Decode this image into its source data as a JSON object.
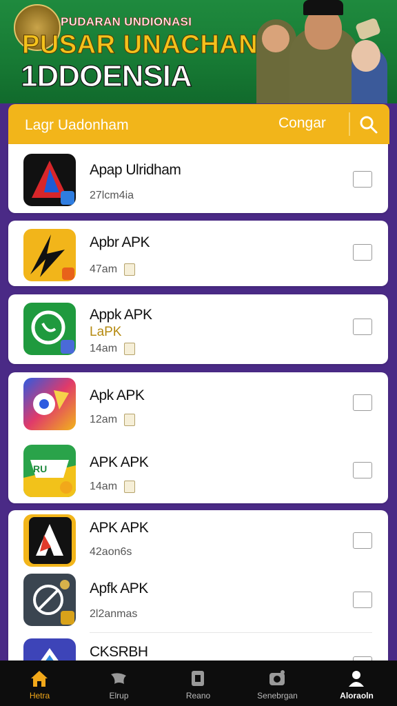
{
  "banner": {
    "subtitle": "PUDARAN UNDIONASI",
    "title_line1": "PUSAR UNACHAN",
    "title_line2": "1DDOENSIA"
  },
  "search": {
    "placeholder": "Lagr Uadonham",
    "button_label": "Congar"
  },
  "apps": [
    {
      "name": "Apap Ulridham",
      "tag": "",
      "size": "27lcm4ia",
      "icon": "a-logo-red-blue-icon"
    },
    {
      "name": "Apbr APK",
      "tag": "",
      "size": "47am",
      "icon": "yellow-lightning-icon"
    },
    {
      "name": "Appk APK",
      "tag": "LaPK",
      "size": "14am",
      "icon": "green-whatsapp-icon"
    },
    {
      "name": "Apk APK",
      "tag": "",
      "size": "12am",
      "icon": "colorful-play-icon"
    },
    {
      "name": "APK APK",
      "tag": "",
      "size": "14am",
      "icon": "green-shield-icon"
    },
    {
      "name": "APK APK",
      "tag": "",
      "size": "42aon6s",
      "icon": "yellow-a-logo-icon"
    },
    {
      "name": "Apfk APK",
      "tag": "",
      "size": "2l2anmas",
      "icon": "slate-compass-icon"
    },
    {
      "name": "CKSRBH",
      "tag": "",
      "size": "",
      "icon": "blue-delta-icon"
    }
  ],
  "nav": [
    {
      "label": "Hetra",
      "icon": "home-icon",
      "state": "active"
    },
    {
      "label": "Elrup",
      "icon": "bird-icon",
      "state": "normal"
    },
    {
      "label": "Reano",
      "icon": "file-icon",
      "state": "normal"
    },
    {
      "label": "Senebrgan",
      "icon": "camera-icon",
      "state": "normal"
    },
    {
      "label": "Aloraoln",
      "icon": "user-icon",
      "state": "bold"
    }
  ],
  "colors": {
    "accent": "#f2b51a",
    "banner_green": "#1f8a3e",
    "background_purple": "#4a2a86",
    "nav_active": "#f2a81a"
  }
}
